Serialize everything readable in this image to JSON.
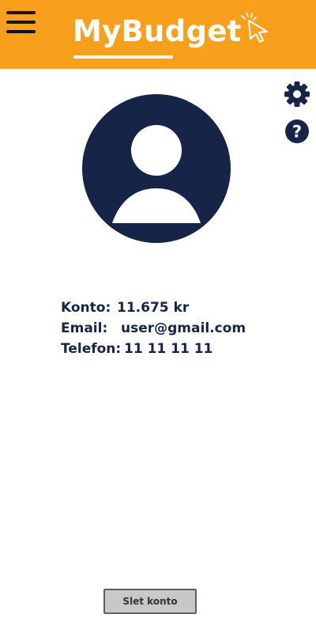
{
  "app": {
    "title": "MyBudget"
  },
  "icons": {
    "menu": "hamburger-menu-icon",
    "logo_cursor": "cursor-click-icon",
    "settings": "gear-icon",
    "help": "help-icon",
    "avatar": "user-avatar-icon"
  },
  "colors": {
    "header_bg": "#f8a01b",
    "navy": "#162447",
    "button_bg": "#c8c8c8",
    "button_border": "#606060"
  },
  "account": {
    "balance_label": "Konto:",
    "balance_value": "11.675 kr",
    "email_label": "Email:",
    "email_value": "user@gmail.com",
    "phone_label": "Telefon:",
    "phone_value": "11 11 11 11"
  },
  "actions": {
    "delete_label": "Slet konto"
  }
}
